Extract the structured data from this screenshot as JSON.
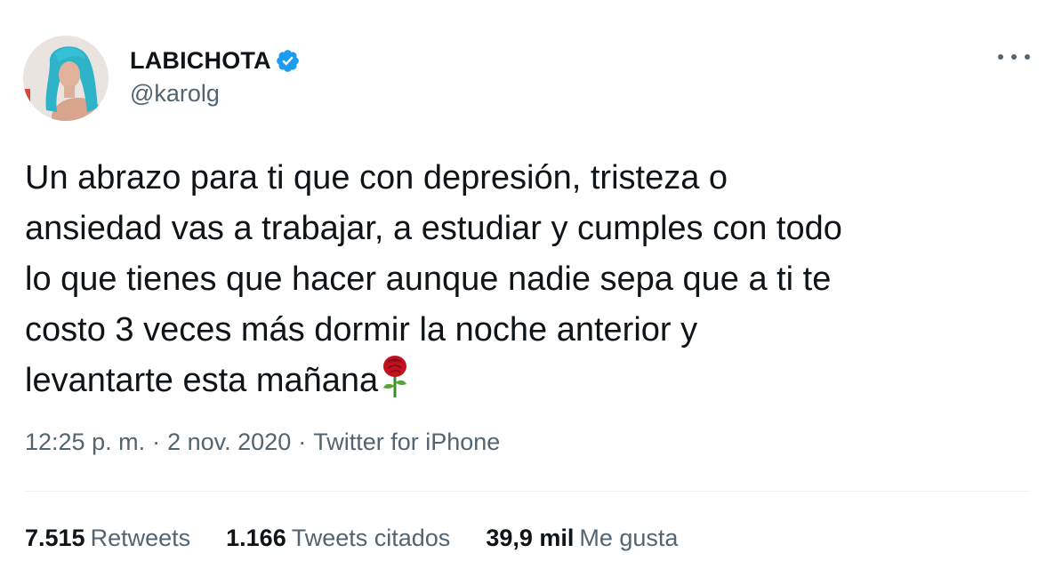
{
  "author": {
    "display_name": "LABICHOTA",
    "handle": "@karolg",
    "verified_icon": "verified-badge-icon",
    "avatar_icon": "avatar-photo"
  },
  "more_icon": "more-options-icon",
  "tweet": {
    "lines": [
      "Un abrazo para ti que con depresión, tristeza o",
      "ansiedad vas a trabajar, a estudiar y cumples con todo",
      "lo que tienes que hacer aunque nadie sepa que a ti te",
      "costo 3 veces más dormir la noche anterior y",
      "levantarte esta mañana"
    ],
    "emoji_icon": "rose-icon"
  },
  "meta": {
    "time": "12:25 p. m.",
    "separator": "·",
    "date": "2 nov. 2020",
    "source": "Twitter for iPhone"
  },
  "stats": [
    {
      "count": "7.515",
      "label": "Retweets"
    },
    {
      "count": "1.166",
      "label": "Tweets citados"
    },
    {
      "count": "39,9 mil",
      "label": "Me gusta"
    }
  ],
  "colors": {
    "verified_blue": "#1d9bf0",
    "secondary_text": "#536471",
    "primary_text": "#0f1419",
    "divider": "#eff3f4"
  }
}
